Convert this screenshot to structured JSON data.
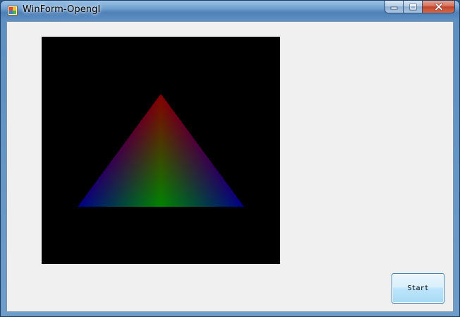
{
  "window": {
    "title": "WinForm-Opengl"
  },
  "caption_buttons": {
    "minimize_icon": "minimize-icon",
    "maximize_icon": "maximize-icon",
    "close_icon": "close-icon"
  },
  "canvas": {
    "background": "#000000",
    "triangle": {
      "vertex_colors": {
        "top": "#ff0000",
        "bottom_center": "#00ff00",
        "bottom_left": "#0000ff",
        "bottom_right": "#0000ff"
      },
      "brightness": 0.52
    }
  },
  "buttons": {
    "start_label": "Start"
  },
  "colors": {
    "client_background": "#f0f0f0",
    "close_button": "#c7432c"
  }
}
